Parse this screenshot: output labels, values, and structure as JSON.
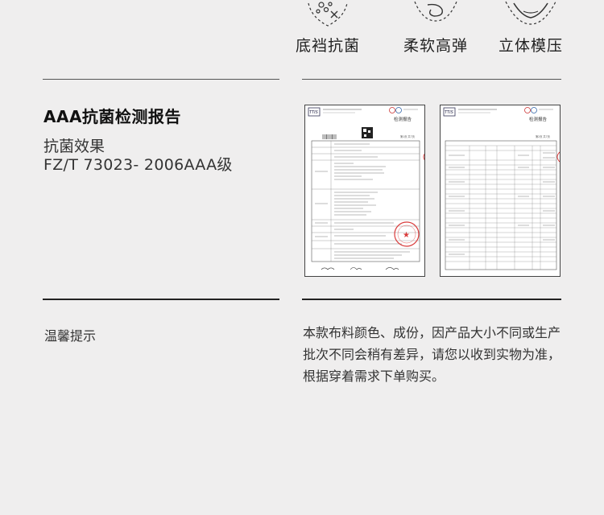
{
  "features": [
    {
      "icon": "antibacterial-icon",
      "label": "底裆抗菌"
    },
    {
      "icon": "soft-elastic-icon",
      "label": "柔软高弹"
    },
    {
      "icon": "3d-molding-icon",
      "label": "立体模压"
    }
  ],
  "certification": {
    "title": "AAA抗菌检测报告",
    "effect_label": "抗菌效果",
    "standard": "FZ/T 73023- 2006AAA级"
  },
  "reports": [
    {
      "logo": "TTIS",
      "heading": "检测报告",
      "page": "第1页 共7页"
    },
    {
      "logo": "TTIS",
      "heading": "检测报告",
      "page": "第2页 共7页"
    }
  ],
  "notice": {
    "label": "温馨提示",
    "text": "本款布料颜色、成份，因产品大小不同或生产批次不同会稍有差异，请您以收到实物为准，根据穿着需求下单购买。"
  },
  "colors": {
    "background": "#efeeee",
    "text": "#333333",
    "stamp": "#d93b3b"
  }
}
